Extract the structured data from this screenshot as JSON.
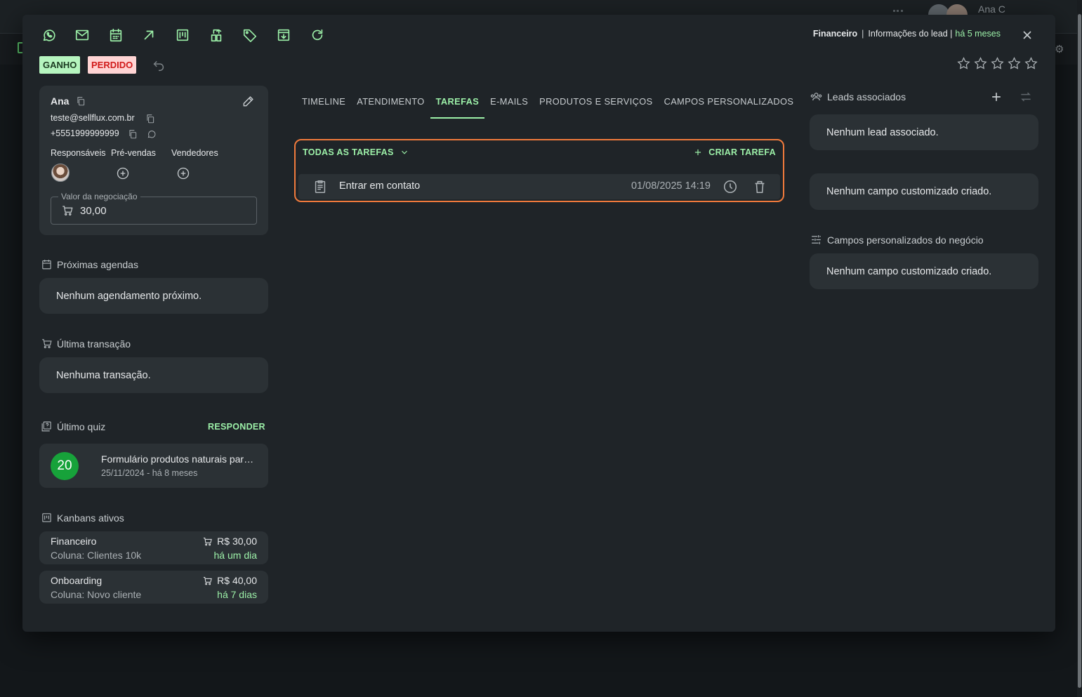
{
  "header": {
    "board": "Financeiro",
    "separator": "|",
    "info_label": "Informações do lead |",
    "time_ago": "há 5 meses"
  },
  "toolbar_icons": [
    "whatsapp-icon",
    "email-icon",
    "calendar-icon",
    "arrow-up-right-icon",
    "kanban-icon",
    "transfer-icon",
    "tag-icon",
    "archive-icon",
    "refresh-icon"
  ],
  "badges": {
    "win": "GANHO",
    "lost": "PERDIDO"
  },
  "contact": {
    "name": "Ana",
    "email": "teste@sellflux.com.br",
    "phone": "+5551999999999",
    "roles": {
      "responsible": "Responsáveis",
      "presales": "Pré-vendas",
      "sellers": "Vendedores"
    },
    "value_label": "Valor da negociação",
    "value": "30,00"
  },
  "sections": {
    "next_schedules": "Próximas agendas",
    "next_schedules_empty": "Nenhum agendamento próximo.",
    "last_transaction": "Última transação",
    "last_transaction_empty": "Nenhuma transação.",
    "last_quiz": "Último quiz",
    "respond": "RESPONDER",
    "active_kanbans": "Kanbans ativos"
  },
  "quiz": {
    "score": "20",
    "title": "Formulário produtos naturais para iniciantes",
    "date": "25/11/2024 - há 8 meses"
  },
  "kanbans": [
    {
      "name": "Financeiro",
      "column": "Coluna: Clientes 10k",
      "value": "R$ 30,00",
      "time": "há um dia"
    },
    {
      "name": "Onboarding",
      "column": "Coluna: Novo cliente",
      "value": "R$ 40,00",
      "time": "há 7 dias"
    }
  ],
  "tabs": [
    "TIMELINE",
    "ATENDIMENTO",
    "TAREFAS",
    "E-MAILS",
    "PRODUTOS E SERVIÇOS",
    "CAMPOS PERSONALIZADOS"
  ],
  "active_tab": "TAREFAS",
  "tasks": {
    "filter": "TODAS AS TAREFAS",
    "create": "CRIAR TAREFA",
    "items": [
      {
        "title": "Entrar em contato",
        "date": "01/08/2025 14:19"
      }
    ]
  },
  "right": {
    "associated_leads": "Leads associados",
    "associated_empty": "Nenhum lead associado.",
    "custom_fields_empty": "Nenhum campo customizado criado.",
    "business_fields": "Campos personalizados do negócio",
    "business_fields_empty": "Nenhum campo customizado criado."
  },
  "background": {
    "user": "Ana C"
  },
  "colors": {
    "accent": "#9cf0a8",
    "highlight_border": "#f07a3c",
    "quiz_score": "#17a23a"
  }
}
